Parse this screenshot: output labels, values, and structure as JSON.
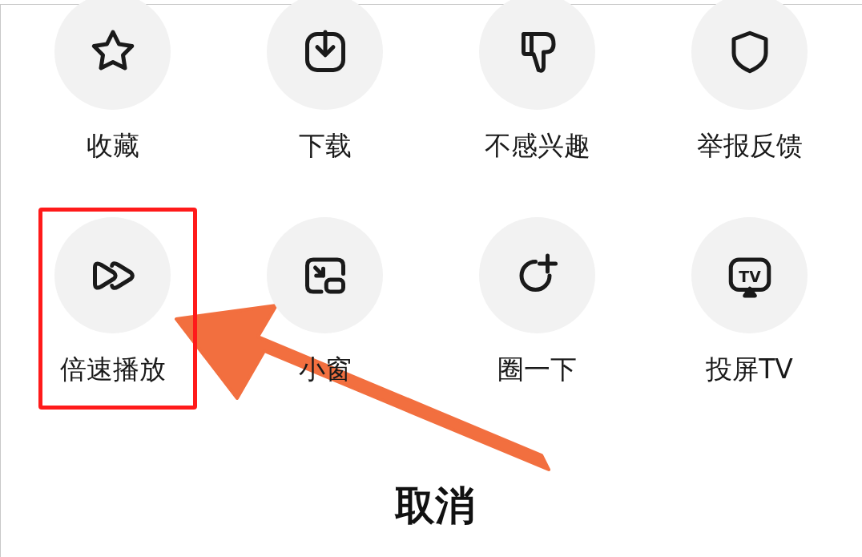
{
  "actions": [
    {
      "label": "收藏",
      "highlighted": false
    },
    {
      "label": "下载",
      "highlighted": false
    },
    {
      "label": "不感兴趣",
      "highlighted": false
    },
    {
      "label": "举报反馈",
      "highlighted": false
    },
    {
      "label": "倍速播放",
      "highlighted": true
    },
    {
      "label": "小窗",
      "highlighted": false
    },
    {
      "label": "圈一下",
      "highlighted": false
    },
    {
      "label": "投屏TV",
      "highlighted": false,
      "icon_text": "TV"
    }
  ],
  "cancel_button": "取消"
}
